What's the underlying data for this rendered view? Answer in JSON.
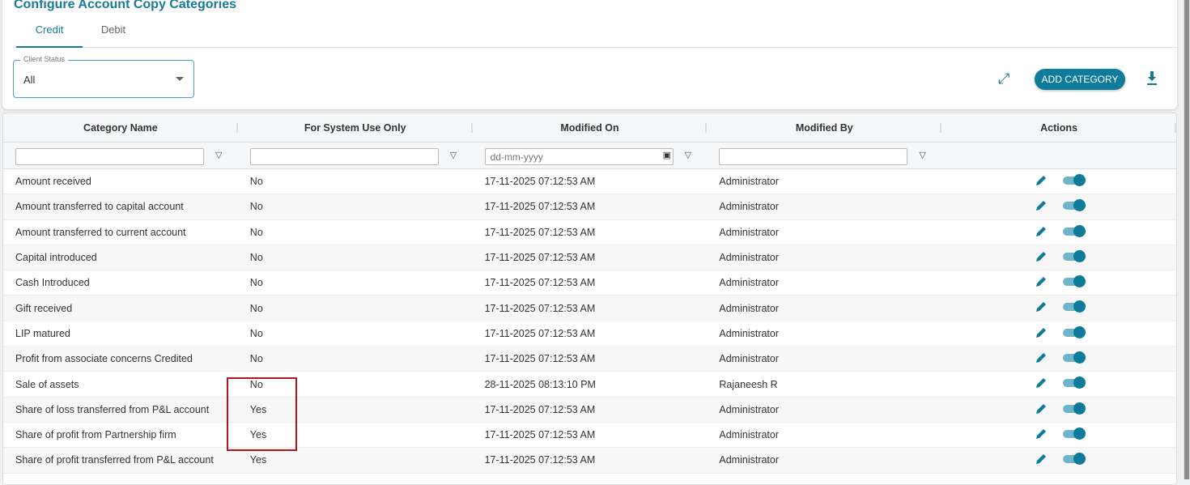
{
  "title": "Configure Account Copy Categories",
  "tabs": [
    {
      "label": "Credit"
    },
    {
      "label": "Debit"
    }
  ],
  "client_status": {
    "label": "Client Status",
    "value": "All"
  },
  "add_category_label": "ADD CATEGORY",
  "columns": [
    "Category Name",
    "For System Use Only",
    "Modified On",
    "Modified By",
    "Actions"
  ],
  "date_placeholder": "dd-mm-yyyy",
  "colors": {
    "accent": "#0e7b9b",
    "highlight": "#b3161c"
  },
  "rows": [
    {
      "name": "Amount received",
      "system": "No",
      "modified_on": "17-11-2025 07:12:53 AM",
      "modified_by": "Administrator"
    },
    {
      "name": "Amount transferred to capital account",
      "system": "No",
      "modified_on": "17-11-2025 07:12:53 AM",
      "modified_by": "Administrator"
    },
    {
      "name": "Amount transferred to current account",
      "system": "No",
      "modified_on": "17-11-2025 07:12:53 AM",
      "modified_by": "Administrator"
    },
    {
      "name": "Capital introduced",
      "system": "No",
      "modified_on": "17-11-2025 07:12:53 AM",
      "modified_by": "Administrator"
    },
    {
      "name": "Cash Introduced",
      "system": "No",
      "modified_on": "17-11-2025 07:12:53 AM",
      "modified_by": "Administrator"
    },
    {
      "name": "Gift received",
      "system": "No",
      "modified_on": "17-11-2025 07:12:53 AM",
      "modified_by": "Administrator"
    },
    {
      "name": "LIP matured",
      "system": "No",
      "modified_on": "17-11-2025 07:12:53 AM",
      "modified_by": "Administrator"
    },
    {
      "name": "Profit from associate concerns Credited",
      "system": "No",
      "modified_on": "17-11-2025 07:12:53 AM",
      "modified_by": "Administrator"
    },
    {
      "name": "Sale of assets",
      "system": "No",
      "modified_on": "28-11-2025 08:13:10 PM",
      "modified_by": "Rajaneesh R"
    },
    {
      "name": "Share of loss transferred from P&L account",
      "system": "Yes",
      "modified_on": "17-11-2025 07:12:53 AM",
      "modified_by": "Administrator"
    },
    {
      "name": "Share of profit from Partnership firm",
      "system": "Yes",
      "modified_on": "17-11-2025 07:12:53 AM",
      "modified_by": "Administrator"
    },
    {
      "name": "Share of profit transferred from P&L account",
      "system": "Yes",
      "modified_on": "17-11-2025 07:12:53 AM",
      "modified_by": "Administrator"
    }
  ]
}
